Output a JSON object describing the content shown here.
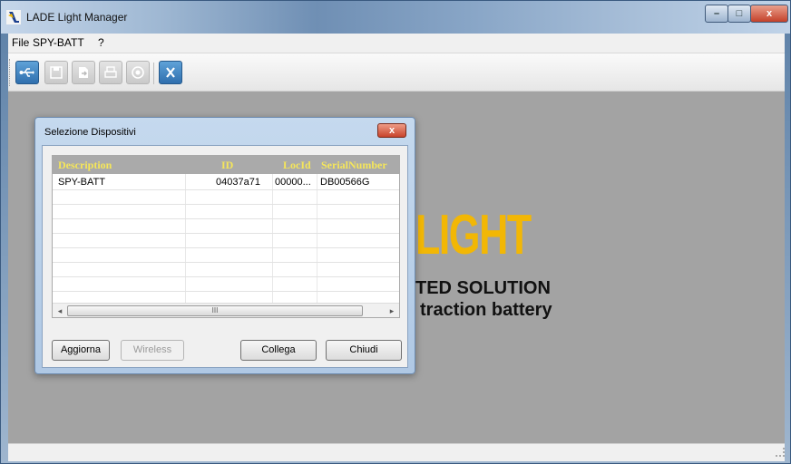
{
  "window": {
    "title": "LADE Light Manager",
    "controls": {
      "minimize": "–",
      "maximize": "□",
      "close": "x"
    }
  },
  "menu": {
    "items": [
      "File",
      "SPY-BATT",
      "?"
    ]
  },
  "toolbar": {
    "buttons": [
      {
        "icon": "usb-connect-icon",
        "state": "active"
      },
      {
        "icon": "save-icon",
        "state": "disabled"
      },
      {
        "icon": "export-icon",
        "state": "disabled"
      },
      {
        "icon": "print-icon",
        "state": "disabled"
      },
      {
        "icon": "record-icon",
        "state": "disabled"
      },
      {
        "icon": "cancel-icon",
        "state": "active"
      }
    ]
  },
  "logo": {
    "word": "LIGHT",
    "line1": "TED SOLUTION",
    "line2": "traction battery",
    "color": "#f2b705"
  },
  "dialog": {
    "title": "Selezione Dispositivi",
    "close_label": "x",
    "list": {
      "columns": [
        "Description",
        "ID",
        "LocId",
        "SerialNumber"
      ],
      "rows": [
        {
          "description": "SPY-BATT",
          "id": "04037a71",
          "locid": "00000...",
          "serial": "DB00566G"
        }
      ],
      "scroll_grip": "III"
    },
    "buttons": {
      "refresh": "Aggiorna",
      "wireless": "Wireless",
      "connect": "Collega",
      "close": "Chiudi"
    }
  }
}
